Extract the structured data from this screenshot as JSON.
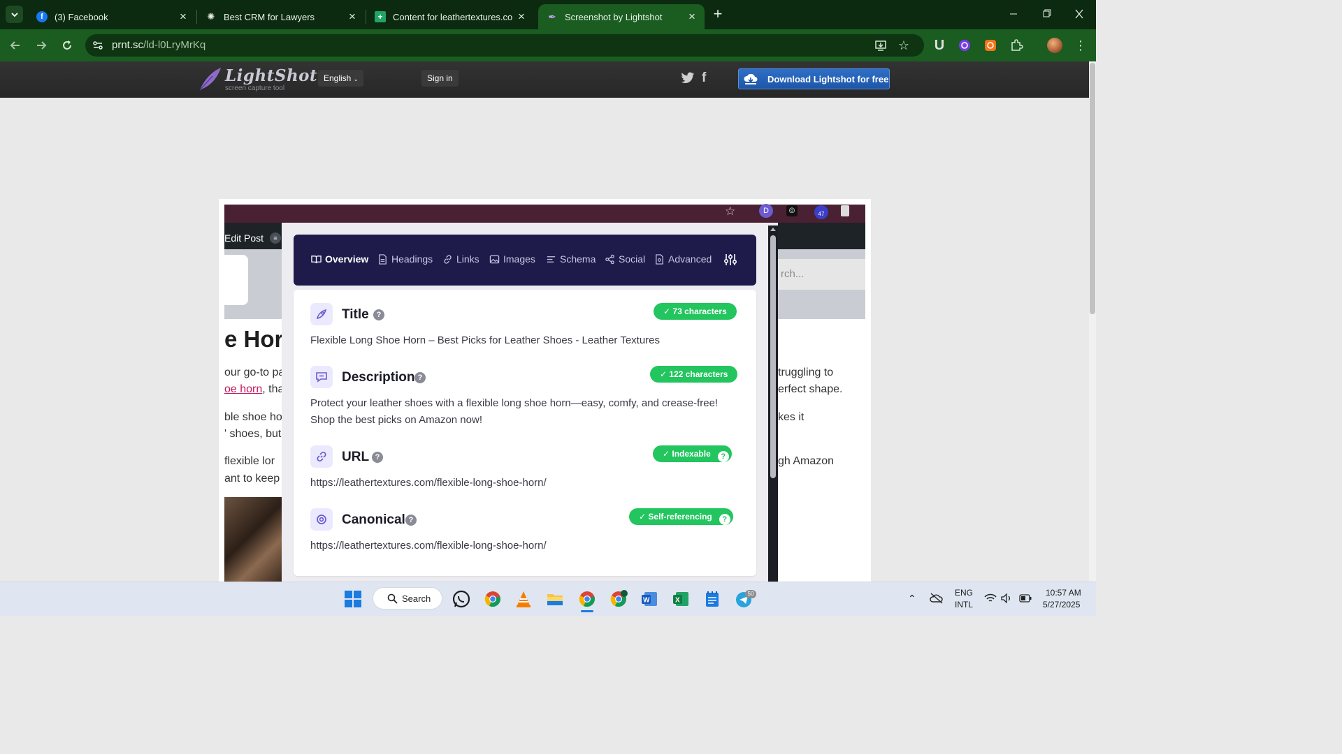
{
  "browser": {
    "tabs": [
      {
        "title": "(3) Facebook"
      },
      {
        "title": "Best CRM for Lawyers"
      },
      {
        "title": "Content for leathertextures.com"
      },
      {
        "title": "Screenshot by Lightshot"
      }
    ],
    "url_host": "prnt.sc",
    "url_path": "/ld-l0LryMrKq"
  },
  "lightshot": {
    "logo": "LightShot",
    "tagline": "screen capture tool",
    "language": "English",
    "signin": "Sign in",
    "download": "Download Lightshot for free"
  },
  "background_page": {
    "edit_post": "Edit Post",
    "heading": "e Hor",
    "search": "rch...",
    "left_lines": [
      "our go-to pa",
      "oe horn",
      ", tha",
      "ble shoe ho",
      "' shoes, but",
      "flexible lor",
      "ant to keep"
    ],
    "right_lines": [
      "truggling to",
      "erfect shape.",
      "kes it",
      "gh Amazon"
    ],
    "ext_badge": "47"
  },
  "seo_panel": {
    "tabs": [
      "Overview",
      "Headings",
      "Links",
      "Images",
      "Schema",
      "Social",
      "Advanced"
    ],
    "sections": [
      {
        "title": "Title",
        "badge": "✓  73 characters",
        "text": "Flexible Long Shoe Horn – Best Picks for Leather Shoes - Leather Textures"
      },
      {
        "title": "Description",
        "badge": "✓  122 characters",
        "text": "Protect your leather shoes with a flexible long shoe horn—easy, comfy, and crease-free! Shop the best picks on Amazon now!"
      },
      {
        "title": "URL",
        "badge": "✓  Indexable",
        "text": "https://leathertextures.com/flexible-long-shoe-horn/"
      },
      {
        "title": "Canonical",
        "badge": "✓  Self-referencing",
        "text": "https://leathertextures.com/flexible-long-shoe-horn/"
      }
    ]
  },
  "taskbar": {
    "search": "Search",
    "lang1": "ENG",
    "lang2": "INTL",
    "time": "10:57 AM",
    "date": "5/27/2025",
    "telegram_badge": "50"
  },
  "colors": {
    "accent_green": "#22c55e",
    "nav_bg": "#1e1b4b",
    "chrome_green": "#1b5c21"
  }
}
